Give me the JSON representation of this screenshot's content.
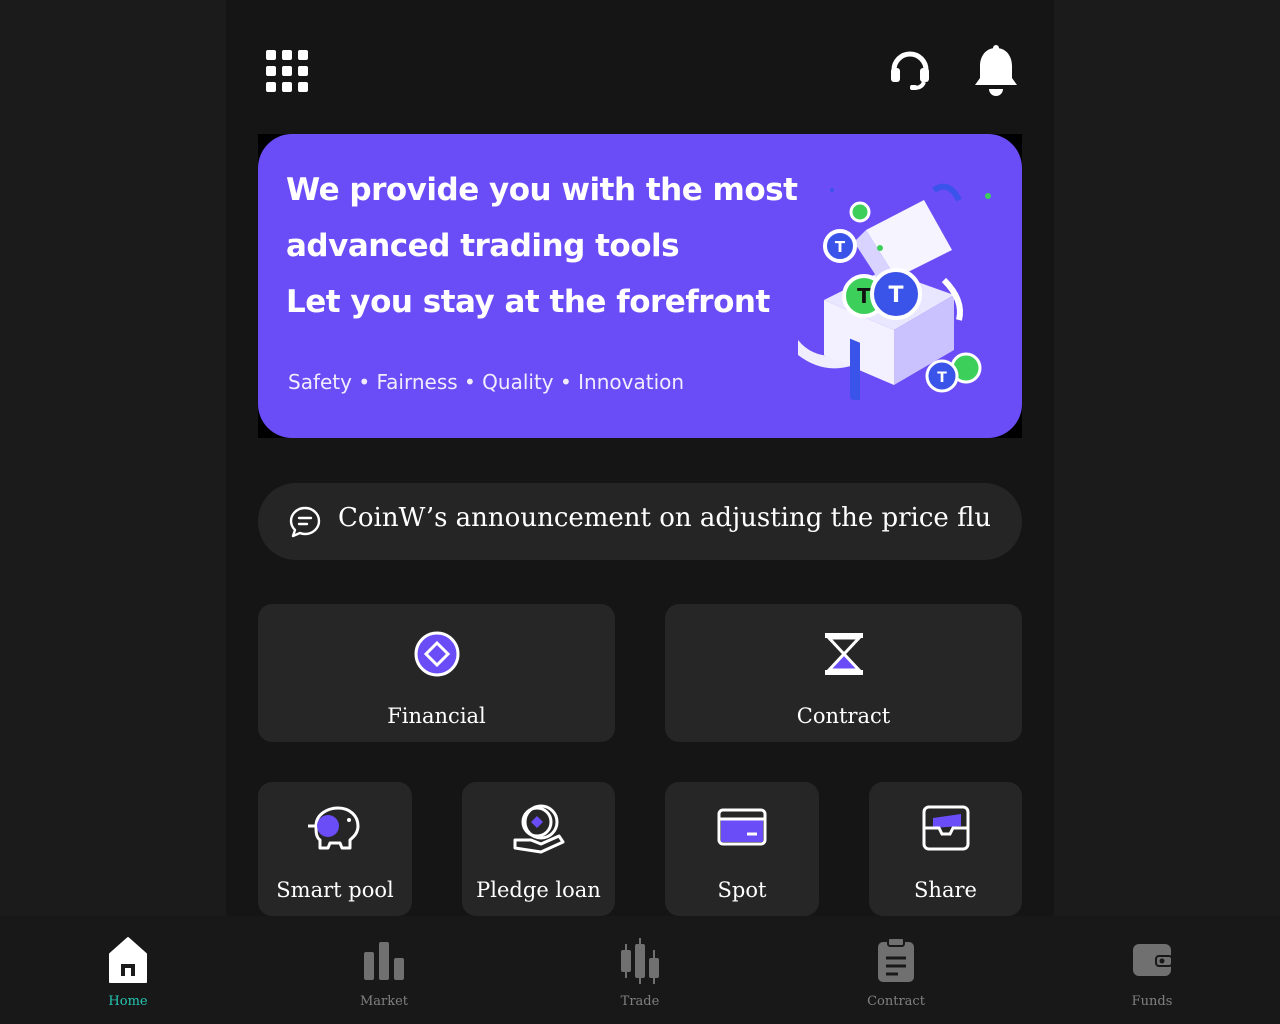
{
  "header": {
    "menu_icon": "grid-menu-icon",
    "support_icon": "headset-support-icon",
    "notification_icon": "bell-icon"
  },
  "banner": {
    "line1": "We provide you with the most",
    "line2": "advanced trading tools",
    "line3": "Let you stay at the forefront",
    "tags": "Safety • Fairness • Quality • Innovation",
    "background": "#6a4df6"
  },
  "announcement": {
    "icon": "chat-bubble-icon",
    "text": "CoinW’s announcement on adjusting the price fluctuation"
  },
  "primary_cards": [
    {
      "label": "Financial",
      "icon": "diamond-coin-icon"
    },
    {
      "label": "Contract",
      "icon": "hourglass-icon"
    }
  ],
  "secondary_cards": [
    {
      "label": "Smart pool",
      "icon": "piggy-bank-icon"
    },
    {
      "label": "Pledge loan",
      "icon": "coin-hand-icon"
    },
    {
      "label": "Spot",
      "icon": "card-icon"
    },
    {
      "label": "Share",
      "icon": "wallet-icon"
    }
  ],
  "bottom_nav": [
    {
      "label": "Home",
      "icon": "home-icon",
      "active": true
    },
    {
      "label": "Market",
      "icon": "bar-chart-icon",
      "active": false
    },
    {
      "label": "Trade",
      "icon": "candlestick-icon",
      "active": false
    },
    {
      "label": "Contract",
      "icon": "clipboard-icon",
      "active": false
    },
    {
      "label": "Funds",
      "icon": "wallet-icon",
      "active": false
    }
  ],
  "colors": {
    "accent": "#6a4df6",
    "active_nav": "#24c7b2",
    "card_bg": "#262626",
    "page_bg": "#151515"
  }
}
